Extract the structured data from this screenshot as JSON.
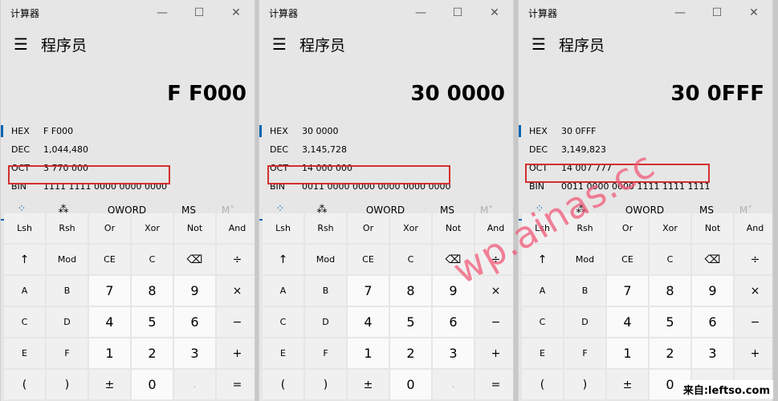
{
  "calculators": [
    {
      "title": "计算器",
      "mode": "程序员",
      "display": "F F000",
      "radix": [
        {
          "label": "HEX",
          "value": "F F000"
        },
        {
          "label": "DEC",
          "value": "1,044,480"
        },
        {
          "label": "OCT",
          "value": "3 770 000"
        },
        {
          "label": "BIN",
          "value": "1111 1111 0000 0000 0000"
        }
      ],
      "tabs": [
        "⁘",
        "⁂",
        "QWORD",
        "MS",
        "M˅"
      ],
      "keys": [
        "Lsh",
        "Rsh",
        "Or",
        "Xor",
        "Not",
        "And",
        "↑",
        "Mod",
        "CE",
        "C",
        "⌫",
        "÷",
        "A",
        "B",
        "7",
        "8",
        "9",
        "×",
        "C",
        "D",
        "4",
        "5",
        "6",
        "−",
        "E",
        "F",
        "1",
        "2",
        "3",
        "+",
        "(",
        ")",
        "±",
        "0",
        ".",
        "="
      ]
    },
    {
      "title": "计算器",
      "mode": "程序员",
      "display": "30 0000",
      "radix": [
        {
          "label": "HEX",
          "value": "30 0000"
        },
        {
          "label": "DEC",
          "value": "3,145,728"
        },
        {
          "label": "OCT",
          "value": "14 000 000"
        },
        {
          "label": "BIN",
          "value": "0011 0000 0000 0000 0000 0000"
        }
      ],
      "tabs": [
        "⁘",
        "⁂",
        "QWORD",
        "MS",
        "M˅"
      ],
      "keys": [
        "Lsh",
        "Rsh",
        "Or",
        "Xor",
        "Not",
        "And",
        "↑",
        "Mod",
        "CE",
        "C",
        "⌫",
        "÷",
        "A",
        "B",
        "7",
        "8",
        "9",
        "×",
        "C",
        "D",
        "4",
        "5",
        "6",
        "−",
        "E",
        "F",
        "1",
        "2",
        "3",
        "+",
        "(",
        ")",
        "±",
        "0",
        ".",
        "="
      ]
    },
    {
      "title": "计算器",
      "mode": "程序员",
      "display": "30 0FFF",
      "radix": [
        {
          "label": "HEX",
          "value": "30 0FFF"
        },
        {
          "label": "DEC",
          "value": "3,149,823"
        },
        {
          "label": "OCT",
          "value": "14 007 777"
        },
        {
          "label": "BIN",
          "value": "0011 0000 0000 1111 1111 1111"
        }
      ],
      "tabs": [
        "⁘",
        "⁂",
        "QWORD",
        "MS",
        "M˅"
      ],
      "keys": [
        "Lsh",
        "Rsh",
        "Or",
        "Xor",
        "Not",
        "And",
        "↑",
        "Mod",
        "CE",
        "C",
        "⌫",
        "÷",
        "A",
        "B",
        "7",
        "8",
        "9",
        "×",
        "C",
        "D",
        "4",
        "5",
        "6",
        "−",
        "E",
        "F",
        "1",
        "2",
        "3",
        "+",
        "(",
        ")",
        "±",
        "0",
        ".",
        "="
      ]
    }
  ],
  "window_controls": {
    "minimize": "—",
    "maximize": "☐",
    "close": "✕"
  },
  "menu_glyph": "☰",
  "watermark": "wp.ainas.cc",
  "source_label": "来自:leftso.com",
  "accent_color": "#0063b1",
  "highlight_color": "#d32f2f"
}
